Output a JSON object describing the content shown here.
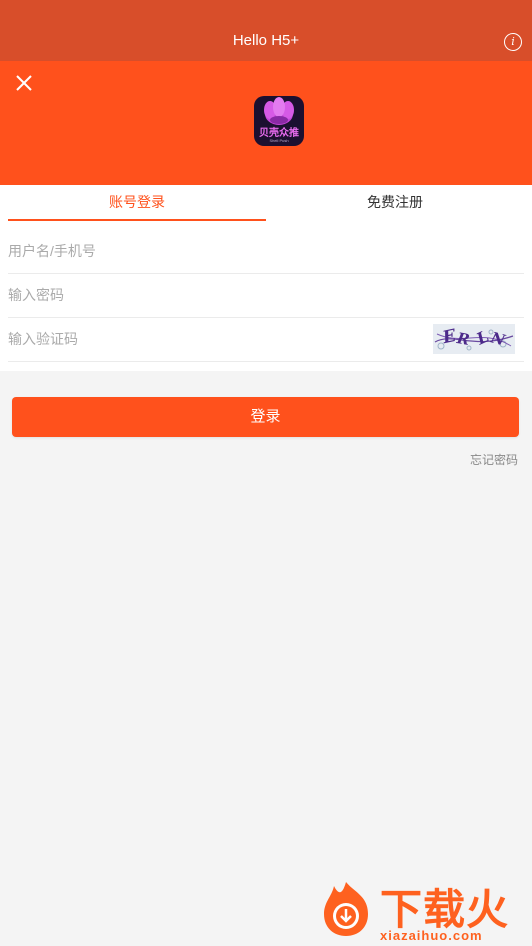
{
  "header": {
    "title": "Hello H5+",
    "info_icon": "info-icon",
    "background": "#d84e2a"
  },
  "hero": {
    "close_icon": "close-icon",
    "app_logo": {
      "name": "贝壳众推",
      "subtitle": "Shell Push"
    },
    "background": "#ff511c"
  },
  "tabs": {
    "login": "账号登录",
    "register": "免费注册",
    "active": "login"
  },
  "form": {
    "username_placeholder": "用户名/手机号",
    "username_value": "",
    "password_placeholder": "输入密码",
    "password_value": "",
    "captcha_placeholder": "输入验证码",
    "captcha_value": "",
    "captcha_image": "captcha-image"
  },
  "actions": {
    "login_label": "登录",
    "forgot_label": "忘记密码"
  },
  "watermark": {
    "brand": "下载火",
    "url": "xiazaihuo.com"
  },
  "colors": {
    "accent": "#ff511c",
    "page_bg": "#f4f4f4"
  }
}
